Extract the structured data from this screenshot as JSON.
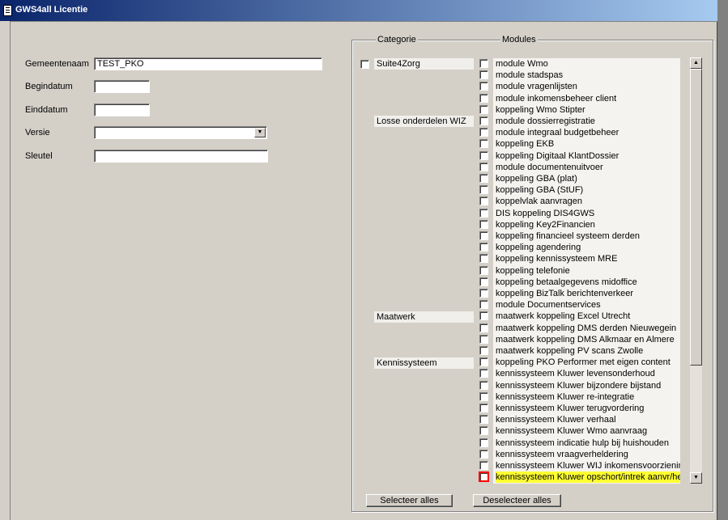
{
  "window": {
    "title": "GWS4all Licentie"
  },
  "form": {
    "gemeentenaam": {
      "label": "Gemeentenaam",
      "value": "TEST_PKO"
    },
    "begindatum": {
      "label": "Begindatum",
      "value": ""
    },
    "einddatum": {
      "label": "Einddatum",
      "value": ""
    },
    "versie": {
      "label": "Versie",
      "value": ""
    },
    "sleutel": {
      "label": "Sleutel",
      "value": ""
    }
  },
  "groups": {
    "categorie": "Categorie",
    "modules": "Modules"
  },
  "categories": [
    {
      "label": "Suite4Zorg",
      "has_checkbox": true
    },
    {
      "label": "Losse onderdelen WIZ",
      "has_checkbox": false
    },
    {
      "label": "Maatwerk",
      "has_checkbox": false
    },
    {
      "label": "Kennissysteem",
      "has_checkbox": false
    }
  ],
  "modules": [
    "module Wmo",
    "module stadspas",
    "module vragenlijsten",
    "module inkomensbeheer client",
    "koppeling Wmo Stipter",
    "module dossierregistratie",
    "module integraal budgetbeheer",
    "koppeling EKB",
    "koppeling Digitaal KlantDossier",
    "module documentenuitvoer",
    "koppeling GBA (plat)",
    "koppeling GBA (StUF)",
    "koppelvlak aanvragen",
    "DIS koppeling DIS4GWS",
    "koppeling Key2Financien",
    "koppeling financieel systeem derden",
    "koppeling agendering",
    "koppeling kennissysteem MRE",
    "koppeling telefonie",
    "koppeling betaalgegevens midoffice",
    "koppeling BizTalk berichtenverkeer",
    "module Documentservices",
    "maatwerk koppeling Excel Utrecht",
    "maatwerk koppeling DMS derden Nieuwegein",
    "maatwerk koppeling DMS Alkmaar en Almere",
    "maatwerk koppeling PV scans Zwolle",
    "koppeling PKO Performer met eigen content",
    "kennissysteem Kluwer levensonderhoud",
    "kennissysteem Kluwer bijzondere bijstand",
    "kennissysteem Kluwer re-integratie",
    "kennissysteem Kluwer terugvordering",
    "kennissysteem Kluwer verhaal",
    "kennissysteem Kluwer Wmo aanvraag",
    "kennissysteem indicatie hulp bij huishouden",
    "kennissysteem vraagverheldering",
    "kennissysteem Kluwer WIJ inkomensvoorziening",
    "kennissysteem Kluwer opschort/intrek aanvr/heron"
  ],
  "selected_module": "kennissysteem Kluwer opschort/intrek aanvr/heron",
  "highlight_color": "#ffff33",
  "buttons": {
    "select_all": "Selecteer alles",
    "deselect_all": "Deselecteer alles"
  }
}
